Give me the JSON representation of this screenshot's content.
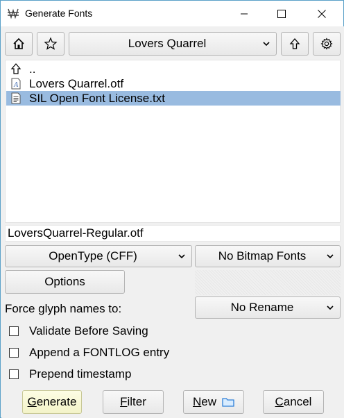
{
  "window": {
    "title": "Generate Fonts",
    "controls": {
      "minimize": "minimize",
      "maximize": "maximize",
      "close": "close"
    }
  },
  "toolbar": {
    "home_icon": "home-icon",
    "bookmark_icon": "star-icon",
    "folder_combo": "Lovers Quarrel",
    "up_icon": "up-arrow-icon",
    "settings_icon": "gear-icon"
  },
  "files": [
    {
      "name": "..",
      "icon": "up-arrow-icon",
      "selected": false
    },
    {
      "name": "Lovers Quarrel.otf",
      "icon": "font-file-icon",
      "selected": false
    },
    {
      "name": "SIL Open Font License.txt",
      "icon": "text-file-icon",
      "selected": true
    }
  ],
  "filename_value": "LoversQuarrel-Regular.otf",
  "format_combo": "OpenType (CFF)",
  "bitmap_combo": "No Bitmap Fonts",
  "options_label": "Options",
  "force_glyph_label": "Force glyph names to:",
  "rename_combo": "No Rename",
  "checkboxes": [
    {
      "label": "Validate Before Saving",
      "checked": false
    },
    {
      "label": "Append a FONTLOG entry",
      "checked": false
    },
    {
      "label": "Prepend timestamp",
      "checked": false
    }
  ],
  "buttons": {
    "generate": "Generate",
    "filter": "Filter",
    "new": "New",
    "cancel": "Cancel"
  },
  "colors": {
    "selection": "#99bbe0",
    "default_button": "#f7f7d4",
    "window_border": "#5aa0c8",
    "folder_icon": "#2d7fd8"
  }
}
